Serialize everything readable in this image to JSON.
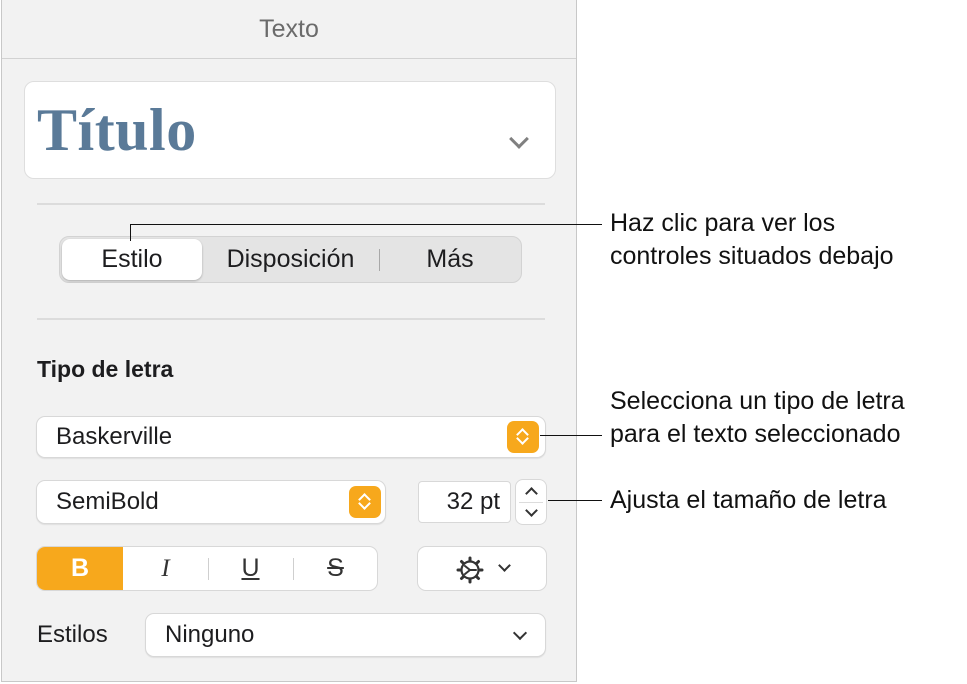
{
  "panel": {
    "title": "Texto"
  },
  "paragraph_style": {
    "name": "Título"
  },
  "tabs": [
    {
      "label": "Estilo",
      "selected": true
    },
    {
      "label": "Disposición",
      "selected": false
    },
    {
      "label": "Más",
      "selected": false
    }
  ],
  "font": {
    "section_label": "Tipo de letra",
    "family": "Baskerville",
    "weight": "SemiBold",
    "size": "32 pt"
  },
  "format_buttons": {
    "bold": "B",
    "italic": "I",
    "underline": "U",
    "strikethrough": "S",
    "bold_active": true
  },
  "char_styles": {
    "label": "Estilos",
    "value": "Ninguno"
  },
  "callouts": [
    {
      "lines": [
        "Haz clic para ver los",
        "controles situados debajo"
      ]
    },
    {
      "lines": [
        "Selecciona un tipo de letra",
        "para el texto seleccionado"
      ]
    },
    {
      "lines": [
        "Ajusta el tamaño de letra"
      ]
    }
  ],
  "colors": {
    "accent": "#f7a81c",
    "title_text": "#5a7a98",
    "panel_bg": "#f2f2f2"
  },
  "icons": [
    "chevron-down-icon",
    "stepper-icon",
    "gear-icon"
  ]
}
